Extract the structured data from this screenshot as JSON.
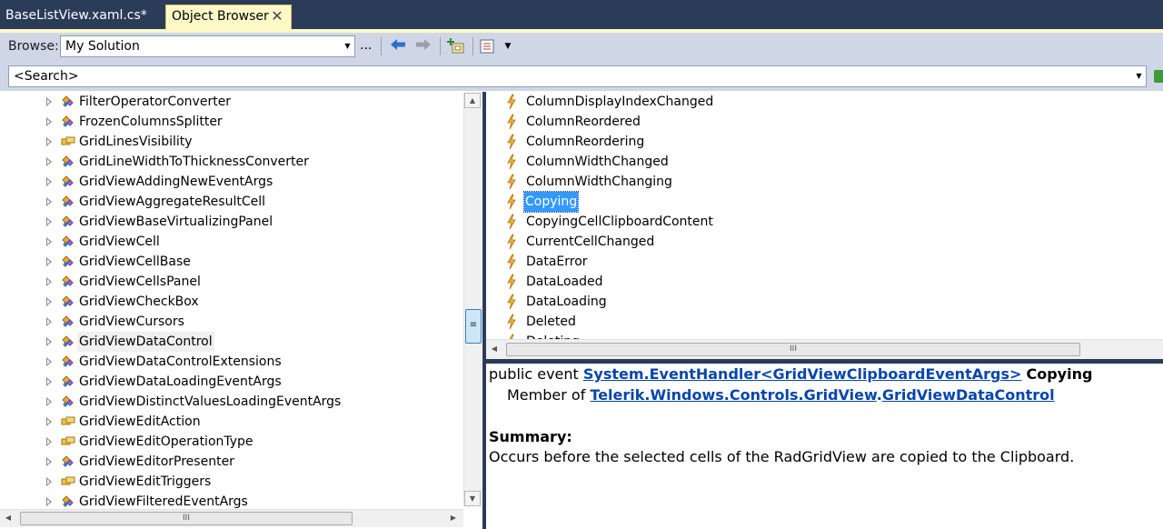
{
  "tabs": [
    {
      "label": "BaseListView.xaml.cs*",
      "active": false
    },
    {
      "label": "Object Browser",
      "active": true
    }
  ],
  "toolbar": {
    "browse_label": "Browse:",
    "browse_value": "My Solution",
    "ellipsis": "..."
  },
  "search": {
    "value": "<Search>"
  },
  "tree": {
    "items": [
      {
        "label": "FilterOperatorConverter",
        "icon": "class-icon"
      },
      {
        "label": "FrozenColumnsSplitter",
        "icon": "class-icon"
      },
      {
        "label": "GridLinesVisibility",
        "icon": "enum-icon"
      },
      {
        "label": "GridLineWidthToThicknessConverter",
        "icon": "class-icon"
      },
      {
        "label": "GridViewAddingNewEventArgs",
        "icon": "class-icon"
      },
      {
        "label": "GridViewAggregateResultCell",
        "icon": "class-icon"
      },
      {
        "label": "GridViewBaseVirtualizingPanel",
        "icon": "class-icon"
      },
      {
        "label": "GridViewCell",
        "icon": "class-icon"
      },
      {
        "label": "GridViewCellBase",
        "icon": "class-icon"
      },
      {
        "label": "GridViewCellsPanel",
        "icon": "class-icon"
      },
      {
        "label": "GridViewCheckBox",
        "icon": "class-icon"
      },
      {
        "label": "GridViewCursors",
        "icon": "class-icon"
      },
      {
        "label": "GridViewDataControl",
        "icon": "class-icon",
        "selected": true
      },
      {
        "label": "GridViewDataControlExtensions",
        "icon": "class-icon"
      },
      {
        "label": "GridViewDataLoadingEventArgs",
        "icon": "class-icon"
      },
      {
        "label": "GridViewDistinctValuesLoadingEventArgs",
        "icon": "class-icon"
      },
      {
        "label": "GridViewEditAction",
        "icon": "enum-icon"
      },
      {
        "label": "GridViewEditOperationType",
        "icon": "enum-icon"
      },
      {
        "label": "GridViewEditorPresenter",
        "icon": "class-icon"
      },
      {
        "label": "GridViewEditTriggers",
        "icon": "enum-icon"
      },
      {
        "label": "GridViewFilteredEventArgs",
        "icon": "class-icon"
      }
    ]
  },
  "members": {
    "items": [
      {
        "label": "ColumnDisplayIndexChanged"
      },
      {
        "label": "ColumnReordered"
      },
      {
        "label": "ColumnReordering"
      },
      {
        "label": "ColumnWidthChanged"
      },
      {
        "label": "ColumnWidthChanging"
      },
      {
        "label": "Copying",
        "selected": true
      },
      {
        "label": "CopyingCellClipboardContent"
      },
      {
        "label": "CurrentCellChanged"
      },
      {
        "label": "DataError"
      },
      {
        "label": "DataLoaded"
      },
      {
        "label": "DataLoading"
      },
      {
        "label": "Deleted"
      },
      {
        "label": "Deleting"
      }
    ]
  },
  "description": {
    "prefix": "public event ",
    "type_link": "System.EventHandler<GridViewClipboardEventArgs>",
    "member_name": "Copying",
    "member_of_label": "Member of ",
    "namespace_link": "Telerik.Windows.Controls.GridView",
    "dot": ".",
    "class_link": "GridViewDataControl",
    "summary_heading": "Summary:",
    "summary_text": "Occurs before the selected cells of the RadGridView are copied to the Clipboard."
  },
  "colors": {
    "chrome_dark": "#2b3c59",
    "active_tab": "#fff9c8",
    "toolbar": "#cfd6e5",
    "selection": "#3399ff",
    "link": "#0645ad"
  }
}
